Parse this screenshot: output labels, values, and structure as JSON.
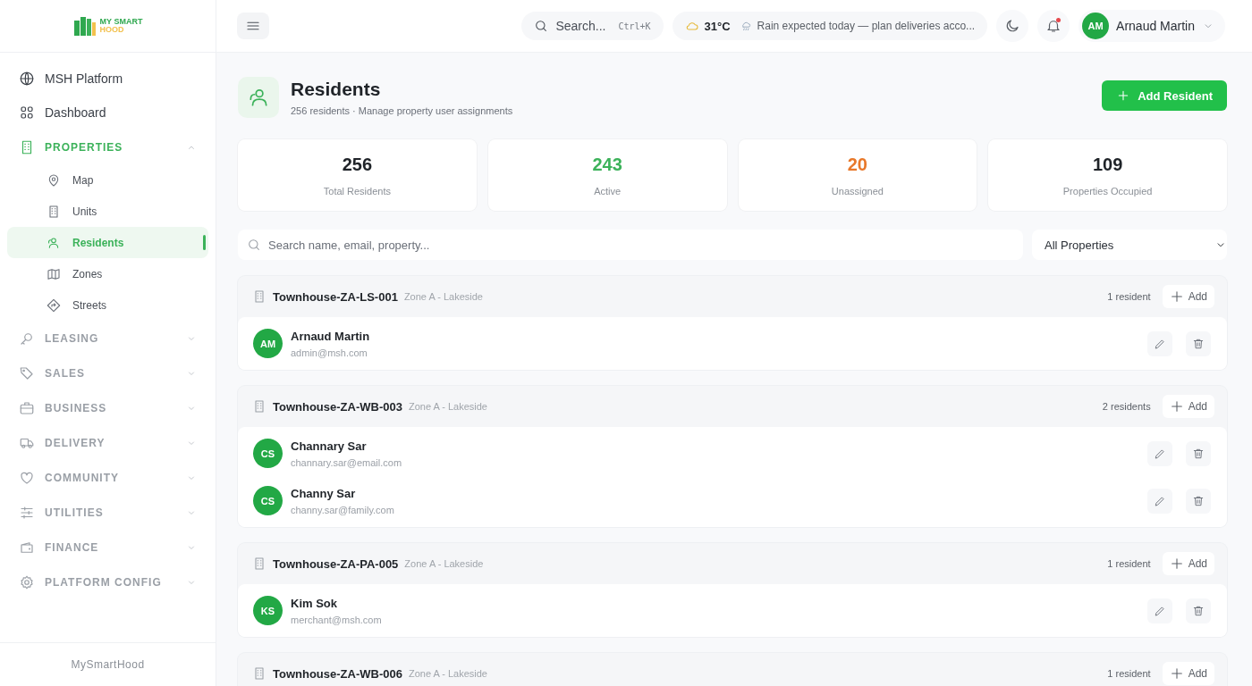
{
  "logo": {
    "line1": "MY SMART",
    "line2": "HOOD"
  },
  "topbar": {
    "search": {
      "placeholder": "Search...",
      "shortcut": "Ctrl+K"
    },
    "weather": {
      "temp": "31°C",
      "message": "Rain expected today — plan deliveries acco..."
    },
    "notification": {
      "unread": true
    },
    "user": {
      "initials": "AM",
      "name": "Arnaud Martin"
    }
  },
  "sidebar": {
    "items": [
      {
        "kind": "link",
        "label": "MSH Platform"
      },
      {
        "kind": "link",
        "label": "Dashboard"
      },
      {
        "kind": "section",
        "label": "PROPERTIES",
        "expanded": true,
        "selected": true,
        "children": [
          {
            "label": "Map",
            "selected": false
          },
          {
            "label": "Units",
            "selected": false
          },
          {
            "label": "Residents",
            "selected": true
          },
          {
            "label": "Zones",
            "selected": false
          },
          {
            "label": "Streets",
            "selected": false
          }
        ]
      },
      {
        "kind": "section",
        "label": "LEASING",
        "expanded": false,
        "selected": false
      },
      {
        "kind": "section",
        "label": "SALES",
        "expanded": false,
        "selected": false
      },
      {
        "kind": "section",
        "label": "BUSINESS",
        "expanded": false,
        "selected": false
      },
      {
        "kind": "section",
        "label": "DELIVERY",
        "expanded": false,
        "selected": false
      },
      {
        "kind": "section",
        "label": "COMMUNITY",
        "expanded": false,
        "selected": false
      },
      {
        "kind": "section",
        "label": "UTILITIES",
        "expanded": false,
        "selected": false
      },
      {
        "kind": "section",
        "label": "FINANCE",
        "expanded": false,
        "selected": false
      },
      {
        "kind": "section",
        "label": "PLATFORM CONFIG",
        "expanded": false,
        "selected": false
      }
    ],
    "footer": "MySmartHood"
  },
  "page": {
    "title": "Residents",
    "subtitle": "256 residents · Manage property user assignments",
    "add_button": "Add Resident"
  },
  "stats": [
    {
      "value": "256",
      "label": "Total Residents",
      "color": "#1f2328"
    },
    {
      "value": "243",
      "label": "Active",
      "color": "#3cb25a"
    },
    {
      "value": "20",
      "label": "Unassigned",
      "color": "#e8782a"
    },
    {
      "value": "109",
      "label": "Properties Occupied",
      "color": "#1f2328"
    }
  ],
  "filters": {
    "search_placeholder": "Search name, email, property...",
    "property_select": "All Properties"
  },
  "groups": [
    {
      "property": "Townhouse-ZA-LS-001",
      "zone": "Zone A - Lakeside",
      "count": "1 resident",
      "add": "Add",
      "residents": [
        {
          "initials": "AM",
          "name": "Arnaud Martin",
          "email": "admin@msh.com"
        }
      ]
    },
    {
      "property": "Townhouse-ZA-WB-003",
      "zone": "Zone A - Lakeside",
      "count": "2 residents",
      "add": "Add",
      "residents": [
        {
          "initials": "CS",
          "name": "Channary Sar",
          "email": "channary.sar@email.com"
        },
        {
          "initials": "CS",
          "name": "Channy Sar",
          "email": "channy.sar@family.com"
        }
      ]
    },
    {
      "property": "Townhouse-ZA-PA-005",
      "zone": "Zone A - Lakeside",
      "count": "1 resident",
      "add": "Add",
      "residents": [
        {
          "initials": "KS",
          "name": "Kim Sok",
          "email": "merchant@msh.com"
        }
      ]
    },
    {
      "property": "Townhouse-ZA-WB-006",
      "zone": "Zone A - Lakeside",
      "count": "1 resident",
      "add": "Add"
    }
  ]
}
